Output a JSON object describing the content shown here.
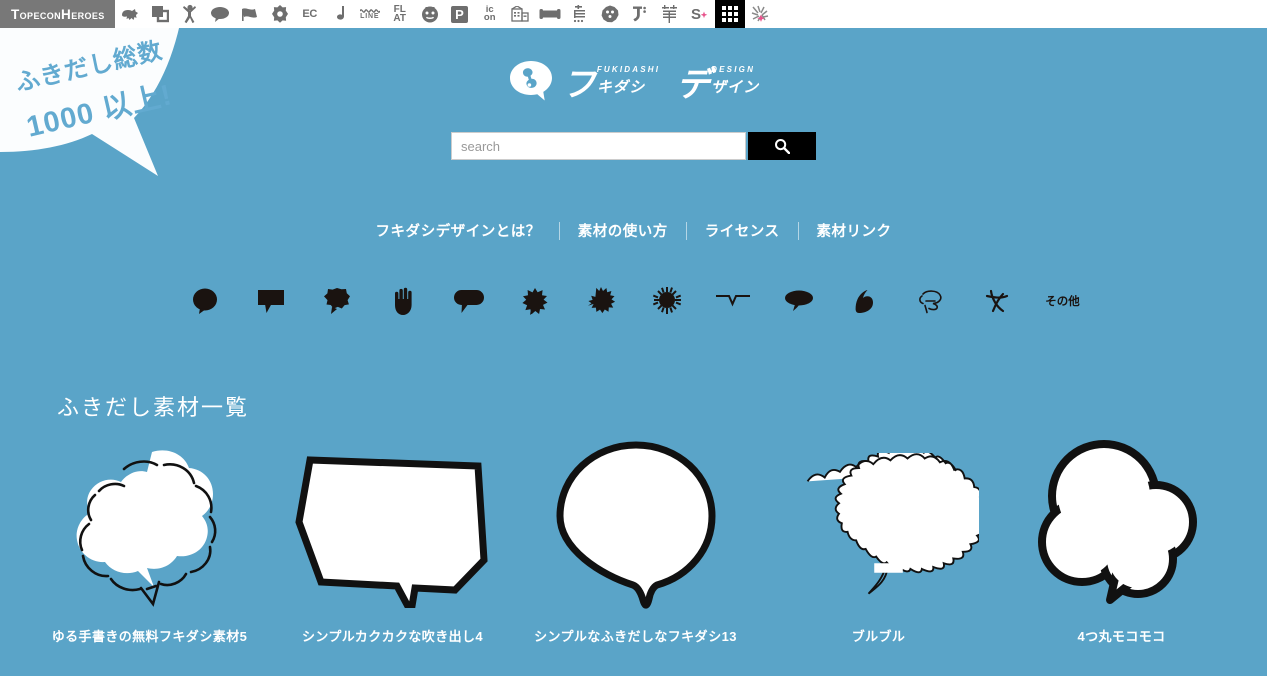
{
  "toolbar": {
    "brand": "TopeconHeroes",
    "items": [
      {
        "name": "boar-icon",
        "label": ""
      },
      {
        "name": "copy-icon",
        "label": ""
      },
      {
        "name": "person-cheer-icon",
        "label": ""
      },
      {
        "name": "speech-bubble-icon",
        "label": ""
      },
      {
        "name": "flag-icon",
        "label": ""
      },
      {
        "name": "flower-icon",
        "label": ""
      },
      {
        "name": "ec-icon",
        "label": "EC"
      },
      {
        "name": "music-note-icon",
        "label": ""
      },
      {
        "name": "line-icon",
        "label": "LINE"
      },
      {
        "name": "flat-icon",
        "label": "FLAT"
      },
      {
        "name": "smiley-icon",
        "label": ""
      },
      {
        "name": "parking-p-icon",
        "label": "P"
      },
      {
        "name": "icon-icon",
        "label": "icon"
      },
      {
        "name": "building-icon",
        "label": ""
      },
      {
        "name": "sofa-icon",
        "label": ""
      },
      {
        "name": "bird-kanji-icon",
        "label": ""
      },
      {
        "name": "polygon-flower-icon",
        "label": ""
      },
      {
        "name": "do-katakana-icon",
        "label": ""
      },
      {
        "name": "brush-kanji-icon",
        "label": ""
      },
      {
        "name": "s-sparkle-icon",
        "label": "S"
      },
      {
        "name": "grid-icon",
        "label": ""
      },
      {
        "name": "sparkle-burst-icon",
        "label": ""
      }
    ]
  },
  "promo": {
    "line1": "ふきだし総数",
    "line2": "1000 以上!",
    "text_color": "#62aad0"
  },
  "logo": {
    "mark": "fukidashi-logo-mark",
    "katakana_1": "フ",
    "romaji_1": "FUKIDASHI",
    "sub_1": "キダシ",
    "katakana_2": "デ",
    "romaji_2": "DESIGN",
    "sub_2": "ザイン"
  },
  "search": {
    "placeholder": "search",
    "value": "",
    "button_icon": "search-icon"
  },
  "nav": {
    "items": [
      "フキダシデザインとは？",
      "素材の使い方",
      "ライセンス",
      "素材リンク"
    ]
  },
  "categories": {
    "icons": [
      "round-bubble-icon",
      "rect-bubble-icon",
      "cloud-bubble-icon",
      "hand-icon",
      "oval-bubble-icon",
      "burst-bubble-icon",
      "spiky-burst-icon",
      "sun-burst-icon",
      "line-bubble-icon",
      "tail-bubble-icon",
      "thumbs-up-icon",
      "scribble-bubble-icon",
      "cross-mark-icon"
    ],
    "other_label": "その他"
  },
  "section": {
    "title": "ふきだし素材一覧"
  },
  "gallery": {
    "items": [
      {
        "caption": "ゆる手書きの無料フキダシ素材5",
        "shape": "hand-drawn-cloud-bubble"
      },
      {
        "caption": "シンプルカクカクな吹き出し4",
        "shape": "angular-polygon-bubble"
      },
      {
        "caption": "シンプルなふきだしなフキダシ13",
        "shape": "round-bubble"
      },
      {
        "caption": "ブルブル",
        "shape": "wavy-oval-bubble"
      },
      {
        "caption": "4つ丸モコモコ",
        "shape": "four-circle-fluffy-bubble"
      }
    ]
  },
  "colors": {
    "background": "#5aa4c8",
    "brand_badge": "#787878",
    "toolbar_bg": "#ffffff",
    "accent_black": "#000000",
    "text_white": "#ffffff"
  }
}
